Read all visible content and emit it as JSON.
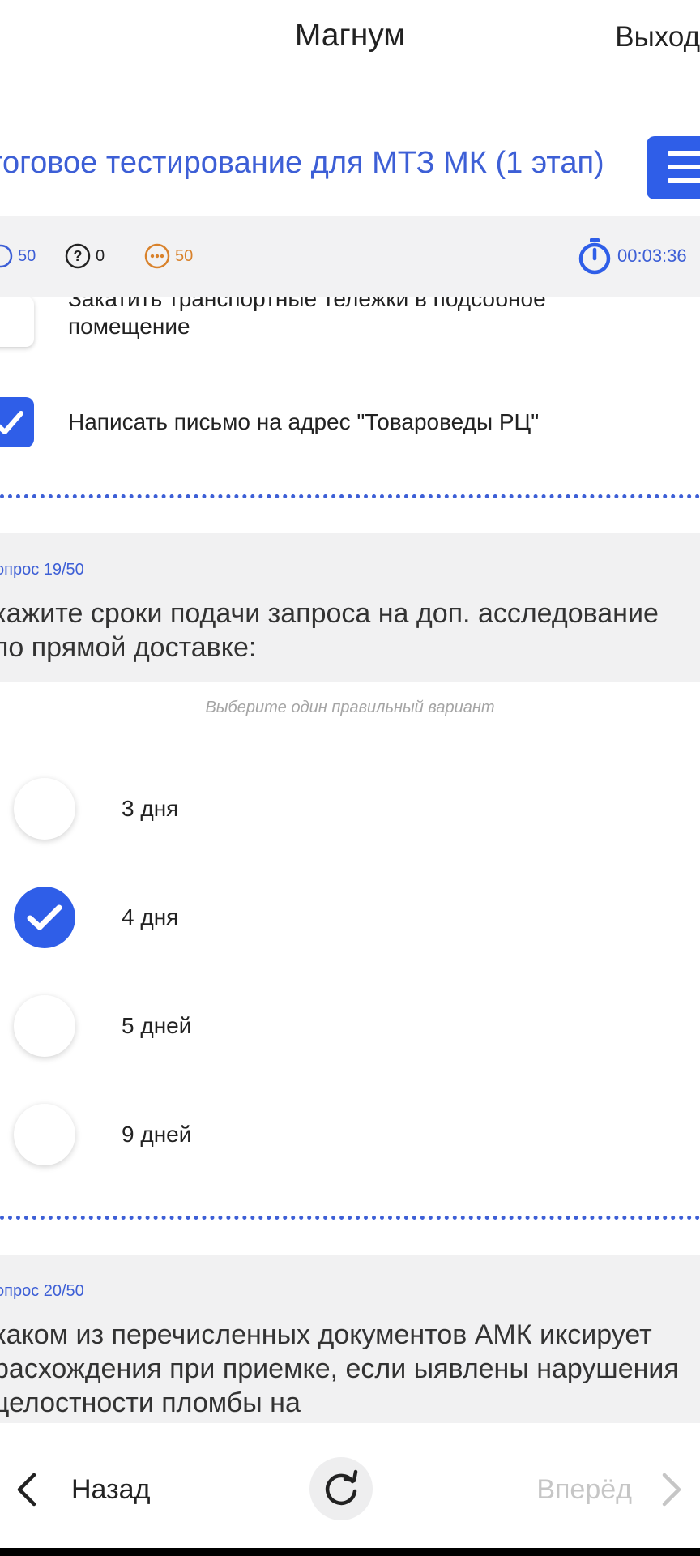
{
  "header": {
    "title": "Магнум",
    "logout_label": "Выход"
  },
  "test": {
    "title": "тоговое тестирование для МТЗ МК (1 этап)"
  },
  "stats": {
    "answered": "50",
    "unanswered": "0",
    "remaining": "50",
    "timer": "00:03:36"
  },
  "prev_question": {
    "options": [
      {
        "label": "Закатить транспортные тележки в подсобное помещение",
        "checked": false
      },
      {
        "label": "Написать письмо на адрес \"Товароведы РЦ\"",
        "checked": true
      }
    ]
  },
  "question_19": {
    "number_label": "опрос 19/50",
    "text": "кажите сроки подачи запроса на доп. асследование по прямой доставке:",
    "hint": "Выберите один правильный вариант",
    "options": [
      {
        "label": "3 дня",
        "checked": false
      },
      {
        "label": "4 дня",
        "checked": true
      },
      {
        "label": "5 дней",
        "checked": false
      },
      {
        "label": "9 дней",
        "checked": false
      }
    ]
  },
  "question_20": {
    "number_label": "опрос 20/50",
    "text": " каком из перечисленных документов АМК иксирует расхождения при приемке, если ыявлены нарушения целостности пломбы на"
  },
  "footer": {
    "back_label": "Назад",
    "forward_label": "Вперёд"
  },
  "colors": {
    "accent": "#2f5ee8",
    "link": "#3d5fd6",
    "orange": "#d9822b",
    "disabled": "#c6c6c6"
  }
}
